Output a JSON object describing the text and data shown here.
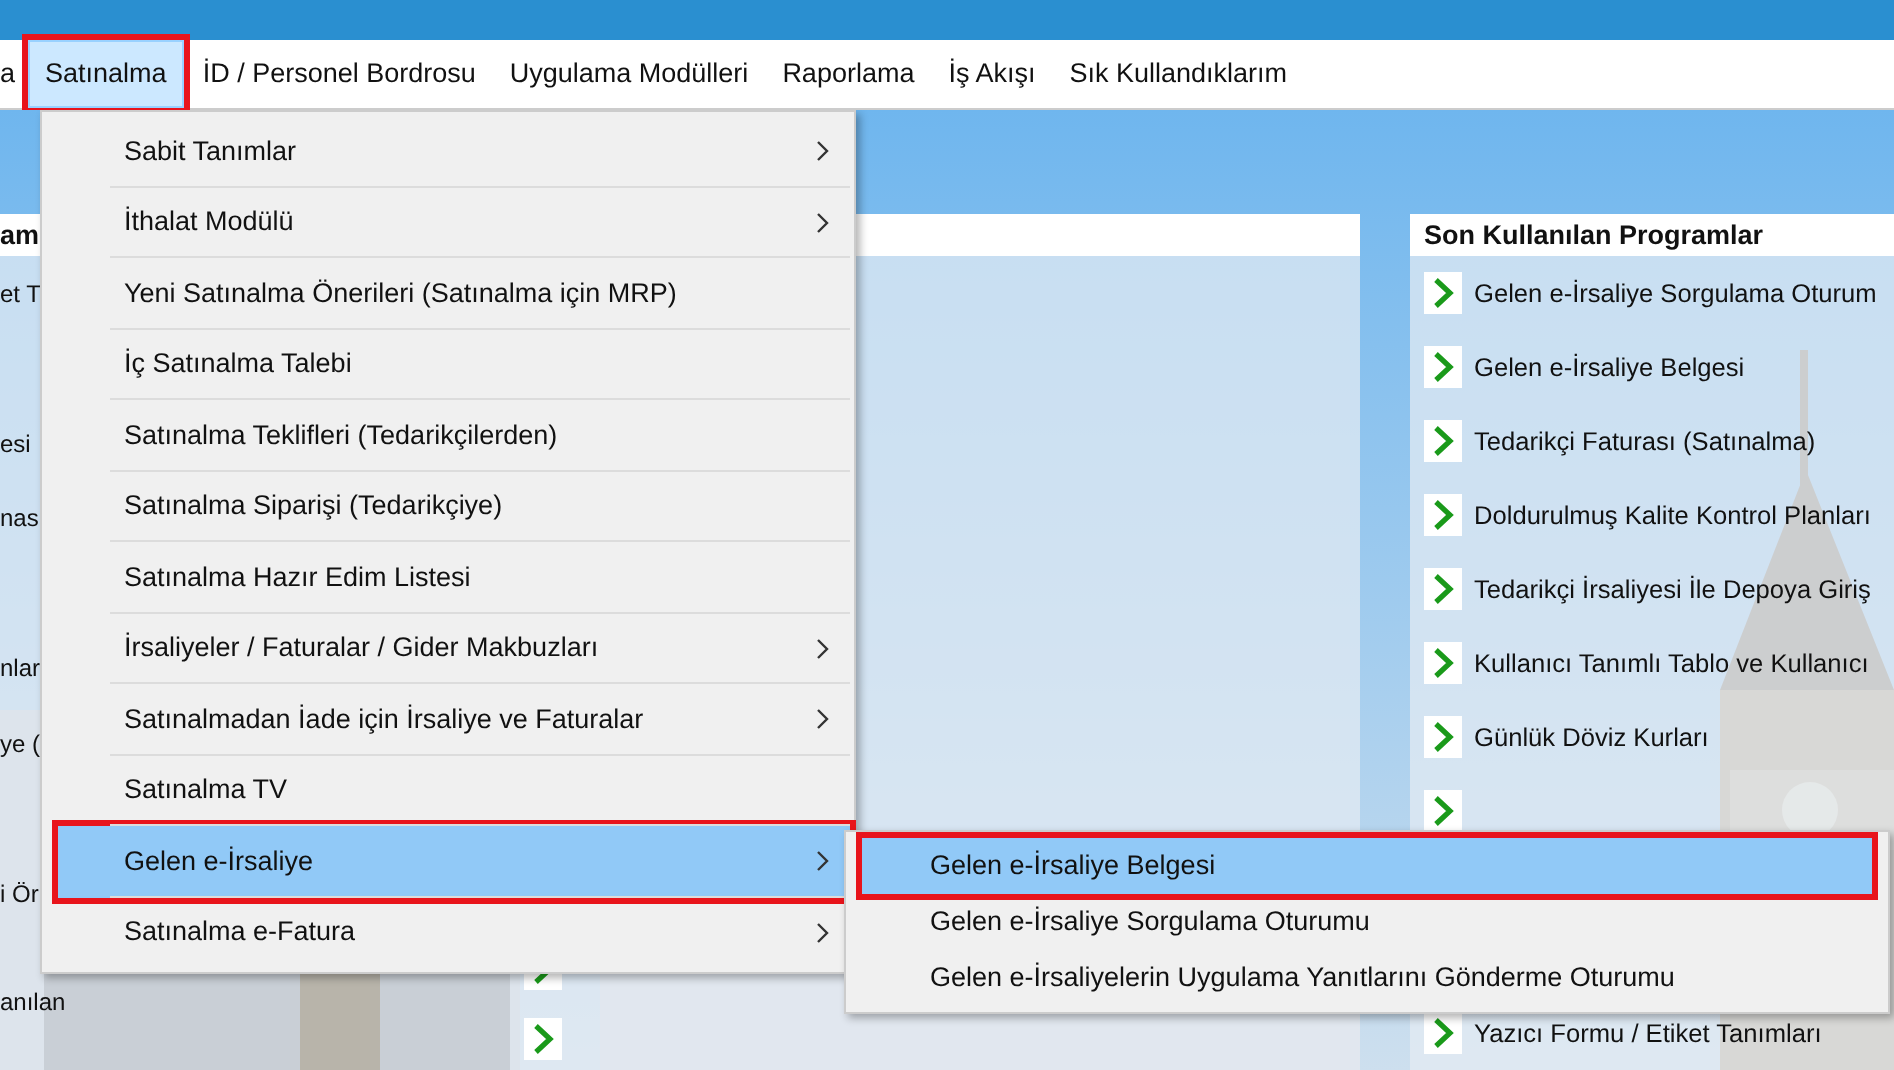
{
  "menu_bar": [
    {
      "label": "a",
      "selected": false,
      "annotated": false
    },
    {
      "label": "Satınalma",
      "selected": true,
      "annotated": true
    },
    {
      "label": "İD / Personel Bordrosu",
      "selected": false,
      "annotated": false
    },
    {
      "label": "Uygulama Modülleri",
      "selected": false,
      "annotated": false
    },
    {
      "label": "Raporlama",
      "selected": false,
      "annotated": false
    },
    {
      "label": "İş Akışı",
      "selected": false,
      "annotated": false
    },
    {
      "label": "Sık Kullandıklarım",
      "selected": false,
      "annotated": false
    }
  ],
  "left_panel": {
    "title": "am",
    "items": [
      {
        "label": "et T"
      },
      {
        "label": "esi"
      },
      {
        "label": "nas"
      },
      {
        "label": "nlar"
      },
      {
        "label": "ye ("
      },
      {
        "label": "i Ör"
      },
      {
        "label": "anılan"
      }
    ]
  },
  "right_panel": {
    "title": "Son Kullanılan Programlar",
    "items": [
      {
        "label": "Gelen e-İrsaliye Sorgulama Oturum"
      },
      {
        "label": "Gelen e-İrsaliye Belgesi"
      },
      {
        "label": "Tedarikçi Faturası (Satınalma)"
      },
      {
        "label": "Doldurulmuş Kalite Kontrol Planları"
      },
      {
        "label": "Tedarikçi İrsaliyesi İle Depoya Giriş"
      },
      {
        "label": "Kullanıcı Tanımlı Tablo ve Kullanıcı"
      },
      {
        "label": "Günlük Döviz Kurları"
      },
      {
        "kind": "icon_only"
      },
      {
        "label": "Yazıcı Formu / Etiket Tanımları"
      }
    ]
  },
  "dropdown_menu": [
    {
      "label": "Sabit Tanımlar",
      "has_submenu": true,
      "selected": false,
      "annotated": false
    },
    {
      "label": "İthalat Modülü",
      "has_submenu": true,
      "selected": false,
      "annotated": false
    },
    {
      "label": "Yeni Satınalma Önerileri (Satınalma için MRP)",
      "has_submenu": false,
      "selected": false,
      "annotated": false
    },
    {
      "label": "İç Satınalma Talebi",
      "has_submenu": false,
      "selected": false,
      "annotated": false
    },
    {
      "label": "Satınalma Teklifleri (Tedarikçilerden)",
      "has_submenu": false,
      "selected": false,
      "annotated": false
    },
    {
      "label": "Satınalma Siparişi (Tedarikçiye)",
      "has_submenu": false,
      "selected": false,
      "annotated": false
    },
    {
      "label": "Satınalma Hazır Edim Listesi",
      "has_submenu": false,
      "selected": false,
      "annotated": false
    },
    {
      "label": "İrsaliyeler / Faturalar / Gider Makbuzları",
      "has_submenu": true,
      "selected": false,
      "annotated": false
    },
    {
      "label": "Satınalmadan İade için İrsaliye ve Faturalar",
      "has_submenu": true,
      "selected": false,
      "annotated": false
    },
    {
      "label": "Satınalma TV",
      "has_submenu": false,
      "selected": false,
      "annotated": false
    },
    {
      "label": "Gelen e-İrsaliye",
      "has_submenu": true,
      "selected": true,
      "annotated": true
    },
    {
      "label": "Satınalma e-Fatura",
      "has_submenu": true,
      "selected": false,
      "annotated": false
    }
  ],
  "submenu": [
    {
      "label": "Gelen e-İrsaliye Belgesi",
      "selected": true,
      "annotated": true
    },
    {
      "label": "Gelen e-İrsaliye Sorgulama Oturumu",
      "selected": false,
      "annotated": false
    },
    {
      "label": "Gelen e-İrsaliyelerin Uygulama Yanıtlarını Gönderme Oturumu",
      "selected": false,
      "annotated": false
    }
  ]
}
